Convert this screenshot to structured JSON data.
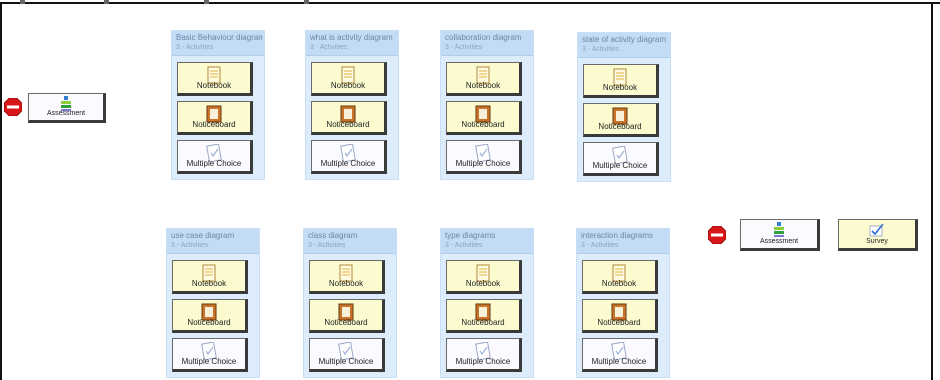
{
  "left_node": {
    "label": "Assessment"
  },
  "groups": [
    {
      "title": "Basic Behaviour diagram",
      "subtitle": "3 - Activities",
      "activities": [
        "Notebook",
        "Noticeboard",
        "Multiple Choice"
      ]
    },
    {
      "title": "what is activity diagram",
      "subtitle": "3 - Activities",
      "activities": [
        "Notebook",
        "Noticeboard",
        "Multiple Choice"
      ]
    },
    {
      "title": "collaboration diagram",
      "subtitle": "3 - Activities",
      "activities": [
        "Notebook",
        "Noticeboard",
        "Multiple Choice"
      ]
    },
    {
      "title": "state of activity diagram",
      "subtitle": "3 - Activities",
      "activities": [
        "Notebook",
        "Noticeboard",
        "Multiple Choice"
      ]
    },
    {
      "title": "use case diagram",
      "subtitle": "3 - Activities",
      "activities": [
        "Notebook",
        "Noticeboard",
        "Multiple Choice"
      ]
    },
    {
      "title": "class diagram",
      "subtitle": "3 - Activities",
      "activities": [
        "Notebook",
        "Noticeboard",
        "Multiple Choice"
      ]
    },
    {
      "title": "type diagrams",
      "subtitle": "3 - Activities",
      "activities": [
        "Notebook",
        "Noticeboard",
        "Multiple Choice"
      ]
    },
    {
      "title": "interaction diagrams",
      "subtitle": "3 - Activities",
      "activities": [
        "Notebook",
        "Noticeboard",
        "Multiple Choice"
      ]
    }
  ],
  "right_nodes": [
    {
      "label": "Assessment"
    },
    {
      "label": "Survey"
    }
  ],
  "colors": {
    "stop_red": "#d81818",
    "group_bg": "#dcecfb",
    "yellow_card": "#fbfbcf"
  }
}
